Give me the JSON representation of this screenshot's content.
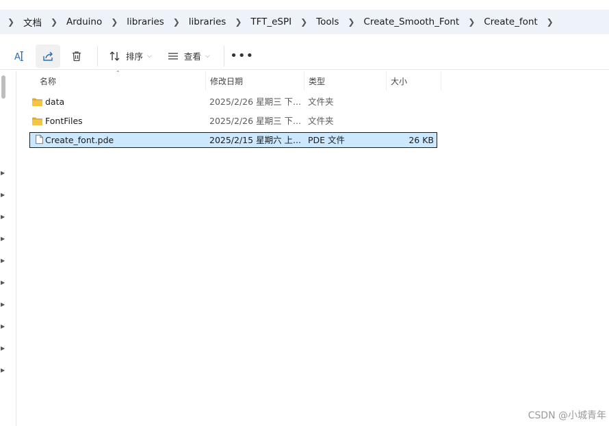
{
  "breadcrumb": {
    "items": [
      "文档",
      "Arduino",
      "libraries",
      "libraries",
      "TFT_eSPI",
      "Tools",
      "Create_Smooth_Font",
      "Create_font"
    ]
  },
  "toolbar": {
    "sort_label": "排序",
    "view_label": "查看",
    "more_label": "•••"
  },
  "columns": {
    "name": "名称",
    "date": "修改日期",
    "type": "类型",
    "size": "大小"
  },
  "files": [
    {
      "name": "data",
      "date": "2025/2/26 星期三 下...",
      "type": "文件夹",
      "size": "",
      "kind": "folder",
      "selected": false
    },
    {
      "name": "FontFiles",
      "date": "2025/2/26 星期三 下...",
      "type": "文件夹",
      "size": "",
      "kind": "folder",
      "selected": false
    },
    {
      "name": "Create_font.pde",
      "date": "2025/2/15 星期六 上...",
      "type": "PDE 文件",
      "size": "26 KB",
      "kind": "file",
      "selected": true
    }
  ],
  "watermark": "CSDN @小城青年",
  "colors": {
    "breadcrumb_bg": "#eef3f9",
    "selection_bg": "#cce8ff",
    "folder": "#f4c542"
  }
}
